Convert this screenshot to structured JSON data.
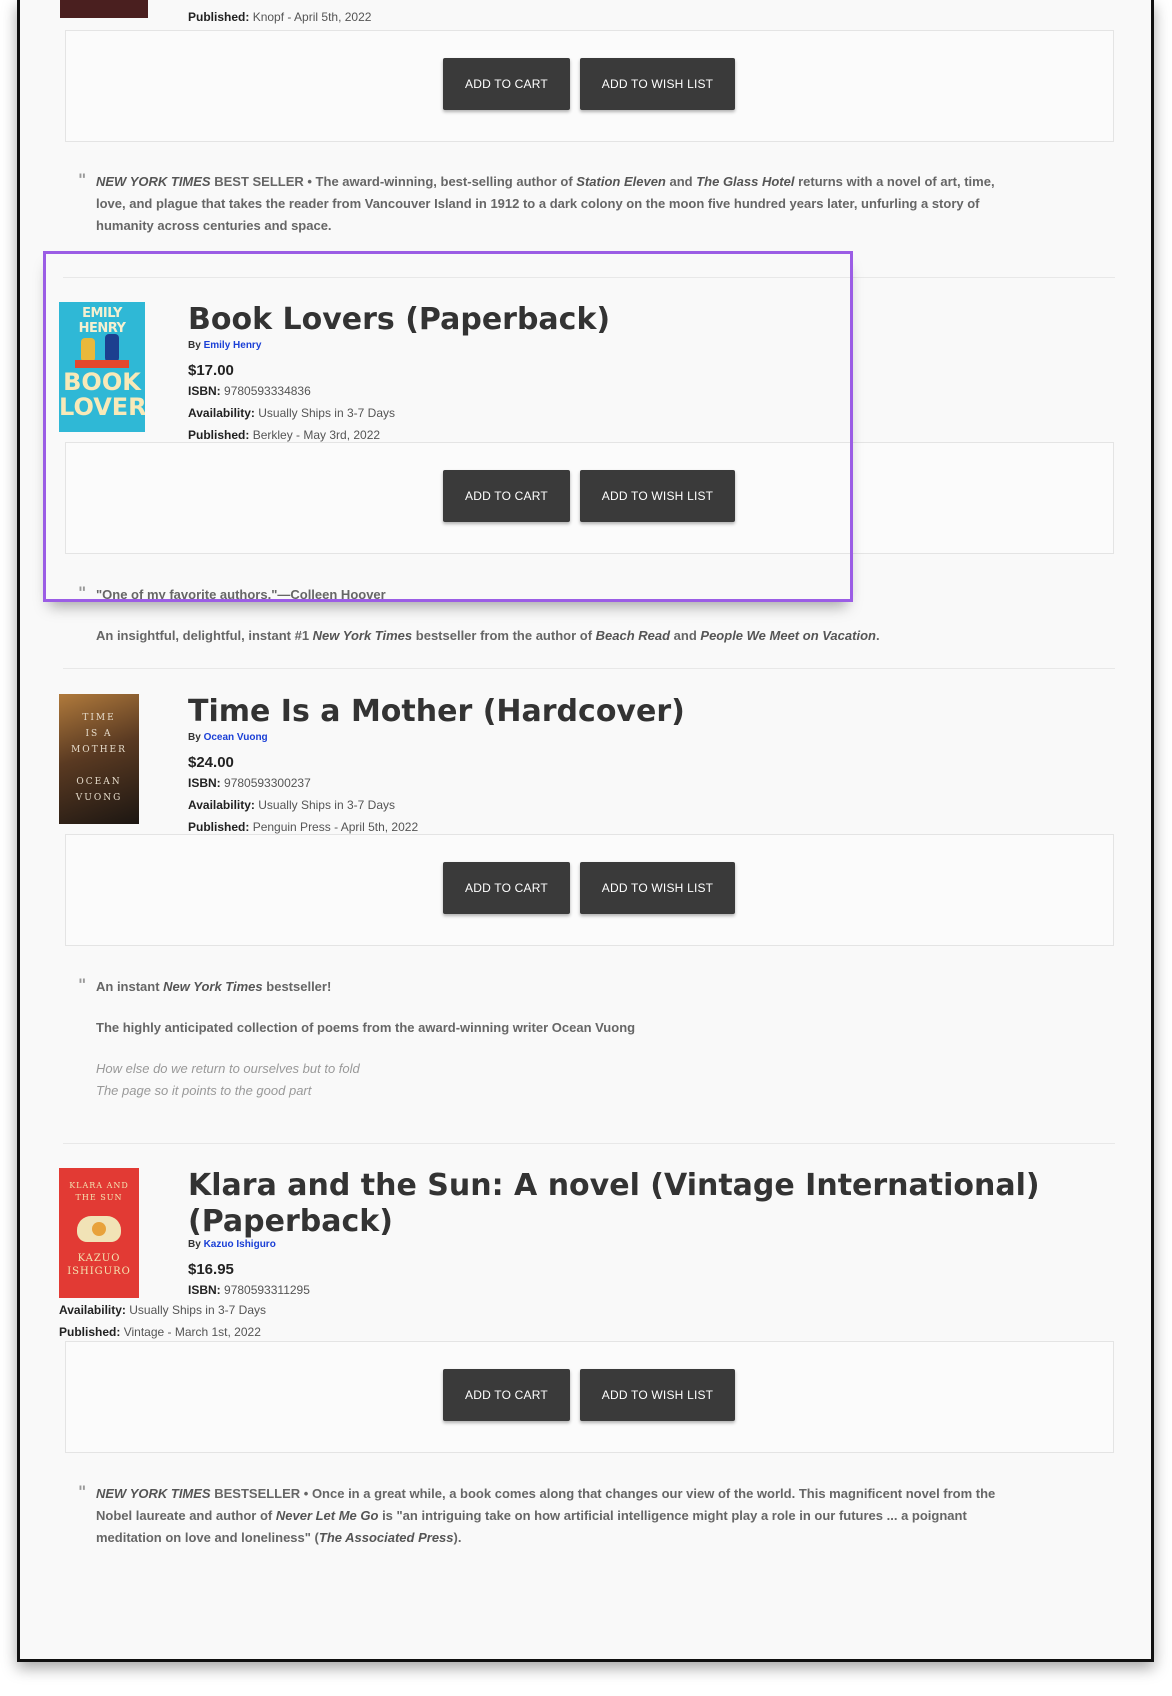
{
  "top_item": {
    "published_label": "Published:",
    "published_value": "Knopf - April 5th, 2022",
    "add_to_cart": "ADD TO CART",
    "add_to_wishlist": "ADD TO WISH LIST",
    "desc_1": "NEW YORK TIMES",
    "desc_2": " BEST SELLER • The award-winning, best-selling author of ",
    "desc_3": "Station Eleven",
    "desc_4": " and ",
    "desc_5": "The Glass Hotel",
    "desc_6": " returns with a novel of art, time, love, and plague that takes the reader from Vancouver Island in 1912 to a dark colony on the moon five hundred years later, unfurling a story of humanity across centuries and space."
  },
  "books": [
    {
      "title": "Book Lovers (Paperback)",
      "by_label": "By",
      "author": "Emily Henry",
      "price": "$17.00",
      "isbn_label": "ISBN:",
      "isbn": "9780593334836",
      "availability_label": "Availability:",
      "availability": "Usually Ships in 3-7 Days",
      "published_label": "Published:",
      "published": "Berkley - May 3rd, 2022",
      "add_to_cart": "ADD TO CART",
      "add_to_wishlist": "ADD TO WISH LIST",
      "cover_author": "EMILY HENRY",
      "cover_title_1": "BOOK",
      "cover_title_2": "LOVERS",
      "quote": "\"One of my favorite authors.\"—Colleen Hoover",
      "desc_1": "An insightful, delightful, instant #1 ",
      "desc_2": "New York Times",
      "desc_3": " bestseller from the author of ",
      "desc_4": "Beach Read",
      "desc_5": " and ",
      "desc_6": "People We Meet on Vacation",
      "desc_7": "."
    },
    {
      "title": "Time Is a Mother (Hardcover)",
      "by_label": "By",
      "author": "Ocean Vuong",
      "price": "$24.00",
      "isbn_label": "ISBN:",
      "isbn": "9780593300237",
      "availability_label": "Availability:",
      "availability": "Usually Ships in 3-7 Days",
      "published_label": "Published:",
      "published": "Penguin Press - April 5th, 2022",
      "add_to_cart": "ADD TO CART",
      "add_to_wishlist": "ADD TO WISH LIST",
      "cover_lines": [
        "TIME",
        "IS A",
        "MOTHER",
        "OCEAN",
        "VUONG"
      ],
      "desc_1": "An instant ",
      "desc_2": "New York Times",
      "desc_3": " bestseller!",
      "desc_line2": "The highly anticipated collection of poems from the award-winning writer Ocean Vuong",
      "poem_1": "How else do we return to ourselves but to fold",
      "poem_2": "The page so it points to the good part"
    },
    {
      "title_1": "Klara and the Sun: A novel (Vintage International)",
      "title_2": "(Paperback)",
      "by_label": "By",
      "author": "Kazuo Ishiguro",
      "price": "$16.95",
      "isbn_label": "ISBN:",
      "isbn": "9780593311295",
      "availability_label": "Availability:",
      "availability": "Usually Ships in 3-7 Days",
      "published_label": "Published:",
      "published": "Vintage - March 1st, 2022",
      "add_to_cart": "ADD TO CART",
      "add_to_wishlist": "ADD TO WISH LIST",
      "cover_lines": [
        "KLARA AND",
        "THE SUN",
        "KAZUO",
        "ISHIGURO"
      ],
      "desc_1": "NEW YORK TIMES",
      "desc_2": " BESTSELLER • Once in a great while, a book comes along that changes our view of the world. This magnificent novel from the Nobel laureate and author of ",
      "desc_3": "Never Let Me Go",
      "desc_4": " is \"an intriguing take on how artificial intelligence might play a role in our futures ... a poignant meditation on love and loneliness\" (",
      "desc_5": "The Associated Press",
      "desc_6": ")."
    }
  ],
  "quote_glyph": "\"",
  "highlight_color": "#9b5de5"
}
